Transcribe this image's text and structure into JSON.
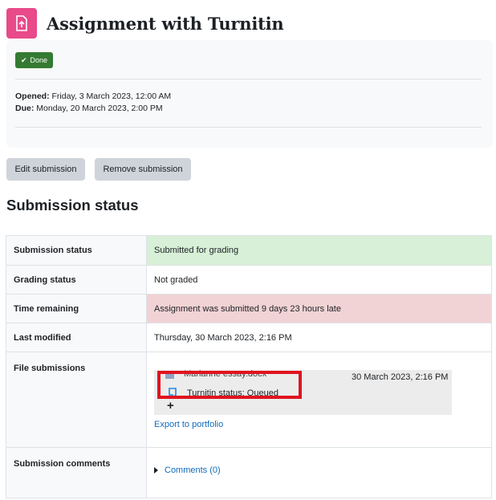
{
  "page": {
    "title": "Assignment with Turnitin",
    "activity_icon": "assignment-icon"
  },
  "completion": {
    "badge_label": "Done",
    "badge_icon": "checkmark-icon"
  },
  "dates": {
    "opened_label": "Opened:",
    "opened_value": "Friday, 3 March 2023, 12:00 AM",
    "due_label": "Due:",
    "due_value": "Monday, 20 March 2023, 2:00 PM"
  },
  "actions": {
    "edit_label": "Edit submission",
    "remove_label": "Remove submission"
  },
  "section_title": "Submission status",
  "status_rows": [
    {
      "label": "Submission status",
      "value": "Submitted for grading"
    },
    {
      "label": "Grading status",
      "value": "Not graded"
    },
    {
      "label": "Time remaining",
      "value": "Assignment was submitted 9 days 23 hours late"
    },
    {
      "label": "Last modified",
      "value": "Thursday, 30 March 2023, 2:16 PM"
    },
    {
      "label": "File submissions"
    },
    {
      "label": "Submission comments"
    }
  ],
  "file": {
    "name": "Marianne essay.docx",
    "date": "30 March 2023, 2:16 PM",
    "turnitin_status": "Turnitin status: Queued",
    "export_label": "Export to portfolio"
  },
  "comments": {
    "label": "Comments (0)"
  },
  "colors": {
    "icon_bg": "#e84a8a",
    "done_badge": "#357a32",
    "submitted_bg": "#d7f0d7",
    "late_bg": "#f1d3d5",
    "link": "#0f6cbf",
    "highlight": "#e0141e"
  }
}
